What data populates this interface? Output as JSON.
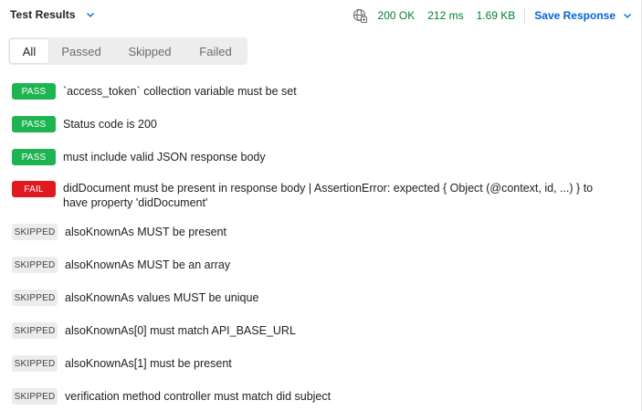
{
  "header": {
    "title": "Test Results",
    "globe_icon": "globe-icon",
    "status": "200 OK",
    "time": "212 ms",
    "size": "1.69 KB",
    "save_label": "Save Response",
    "status_color": "#007f31",
    "accent": "#0265d2"
  },
  "filters": [
    {
      "label": "All",
      "active": true
    },
    {
      "label": "Passed",
      "active": false
    },
    {
      "label": "Skipped",
      "active": false
    },
    {
      "label": "Failed",
      "active": false
    }
  ],
  "badges": {
    "pass": "PASS",
    "fail": "FAIL",
    "skip": "SKIPPED"
  },
  "colors": {
    "pass": "#1fb452",
    "fail": "#e11a22",
    "skip": "#ececec"
  },
  "results": [
    {
      "status": "pass",
      "message": "`access_token` collection variable must be set"
    },
    {
      "status": "pass",
      "message": "Status code is 200"
    },
    {
      "status": "pass",
      "message": "must include valid JSON response body"
    },
    {
      "status": "fail",
      "message": "didDocument must be present in response body | AssertionError: expected { Object (@context, id, ...) } to have property 'didDocument'"
    },
    {
      "status": "skip",
      "message": "alsoKnownAs MUST be present"
    },
    {
      "status": "skip",
      "message": "alsoKnownAs MUST be an array"
    },
    {
      "status": "skip",
      "message": "alsoKnownAs values MUST be unique"
    },
    {
      "status": "skip",
      "message": "alsoKnownAs[0] must match API_BASE_URL"
    },
    {
      "status": "skip",
      "message": "alsoKnownAs[1] must be present"
    },
    {
      "status": "skip",
      "message": "verification method controller must match did subject"
    }
  ]
}
